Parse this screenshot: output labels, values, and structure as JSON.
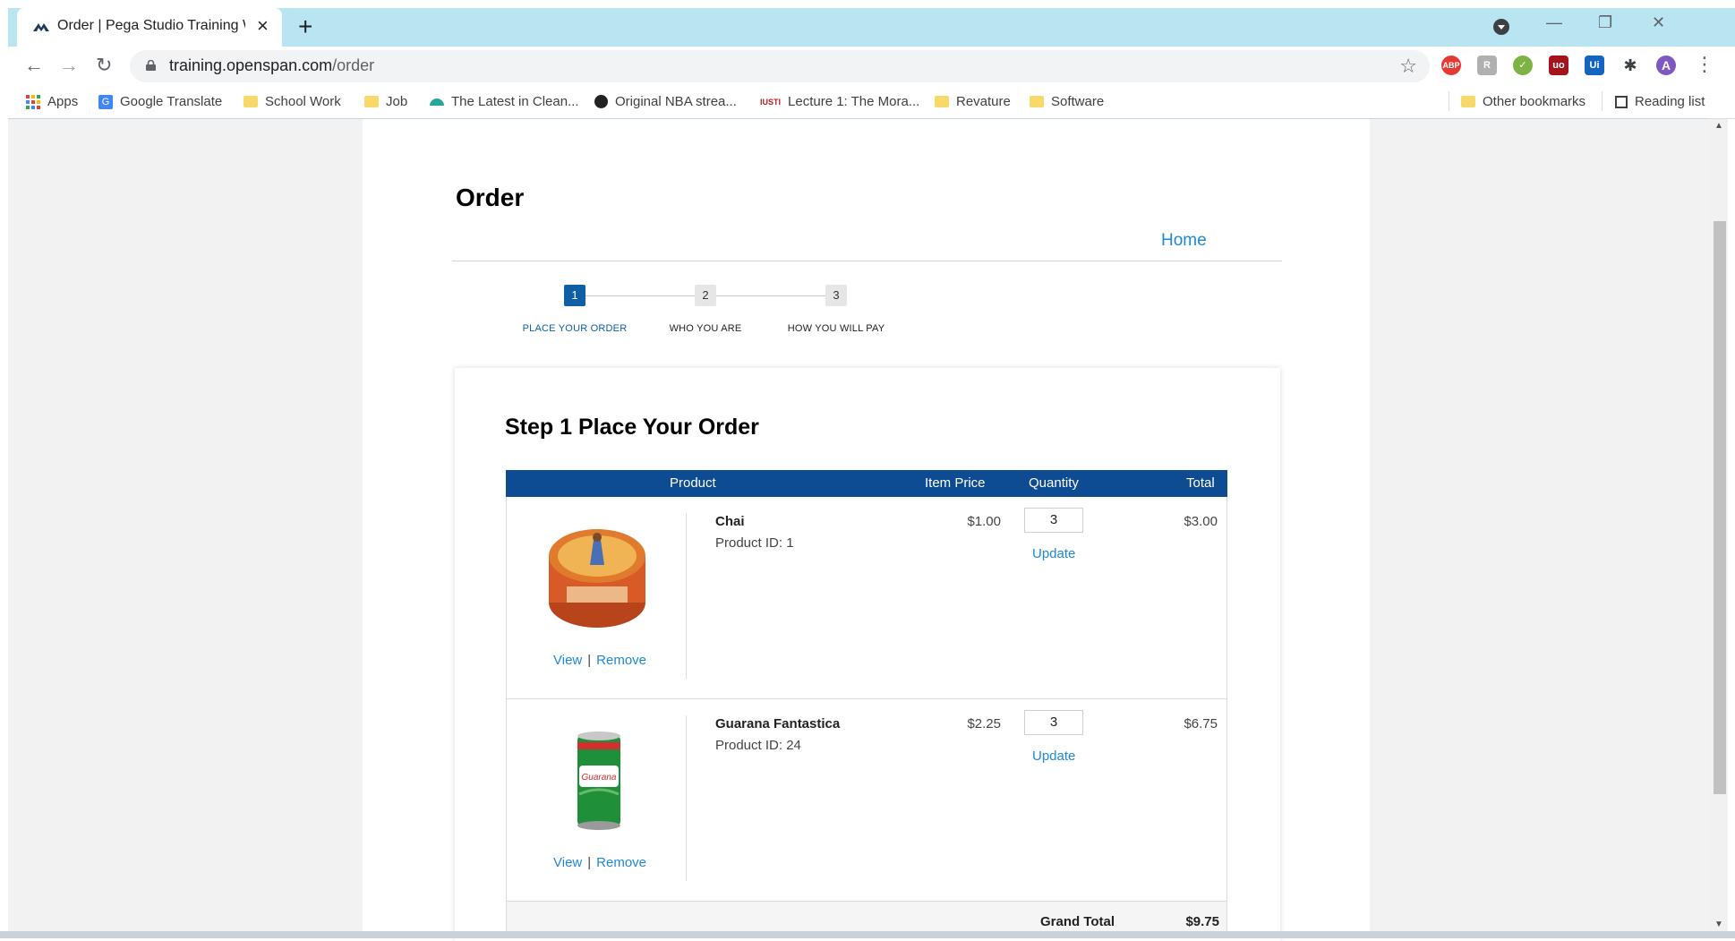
{
  "browser": {
    "tab_title": "Order | Pega Studio Training Web",
    "url_domain": "training.openspan.com",
    "url_path": "/order",
    "bookmarks": [
      {
        "label": "Apps",
        "icon": "apps-grid-icon"
      },
      {
        "label": "Google Translate",
        "icon": "google-translate-icon"
      },
      {
        "label": "School Work",
        "icon": "folder-icon"
      },
      {
        "label": "Job",
        "icon": "folder-icon"
      },
      {
        "label": "The Latest in Clean...",
        "icon": "site-icon"
      },
      {
        "label": "Original NBA strea...",
        "icon": "globe-icon"
      },
      {
        "label": "Lecture 1: The Mora...",
        "icon": "site-icon"
      },
      {
        "label": "Revature",
        "icon": "folder-icon"
      },
      {
        "label": "Software",
        "icon": "folder-icon"
      }
    ],
    "other_bookmarks": "Other bookmarks",
    "reading_list": "Reading list",
    "profile_initial": "A"
  },
  "page": {
    "title": "Order",
    "home_link": "Home"
  },
  "steps": [
    {
      "number": "1",
      "label": "PLACE YOUR ORDER",
      "active": true
    },
    {
      "number": "2",
      "label": "WHO YOU ARE",
      "active": false
    },
    {
      "number": "3",
      "label": "HOW YOU WILL PAY",
      "active": false
    }
  ],
  "order": {
    "heading": "Step 1 Place Your Order",
    "columns": {
      "product": "Product",
      "item_price": "Item Price",
      "quantity": "Quantity",
      "total": "Total"
    },
    "items": [
      {
        "name": "Chai",
        "product_id": "Product ID: 1",
        "price": "$1.00",
        "quantity": "3",
        "total": "$3.00",
        "update": "Update",
        "view": "View",
        "remove": "Remove"
      },
      {
        "name": "Guarana Fantastica",
        "product_id": "Product ID: 24",
        "price": "$2.25",
        "quantity": "3",
        "total": "$6.75",
        "update": "Update",
        "view": "View",
        "remove": "Remove"
      }
    ],
    "grand_total_label": "Grand Total",
    "grand_total": "$9.75"
  },
  "colors": {
    "accent": "#0d4b93",
    "link": "#1e88d6",
    "tabstrip": "#b9e4f2"
  }
}
